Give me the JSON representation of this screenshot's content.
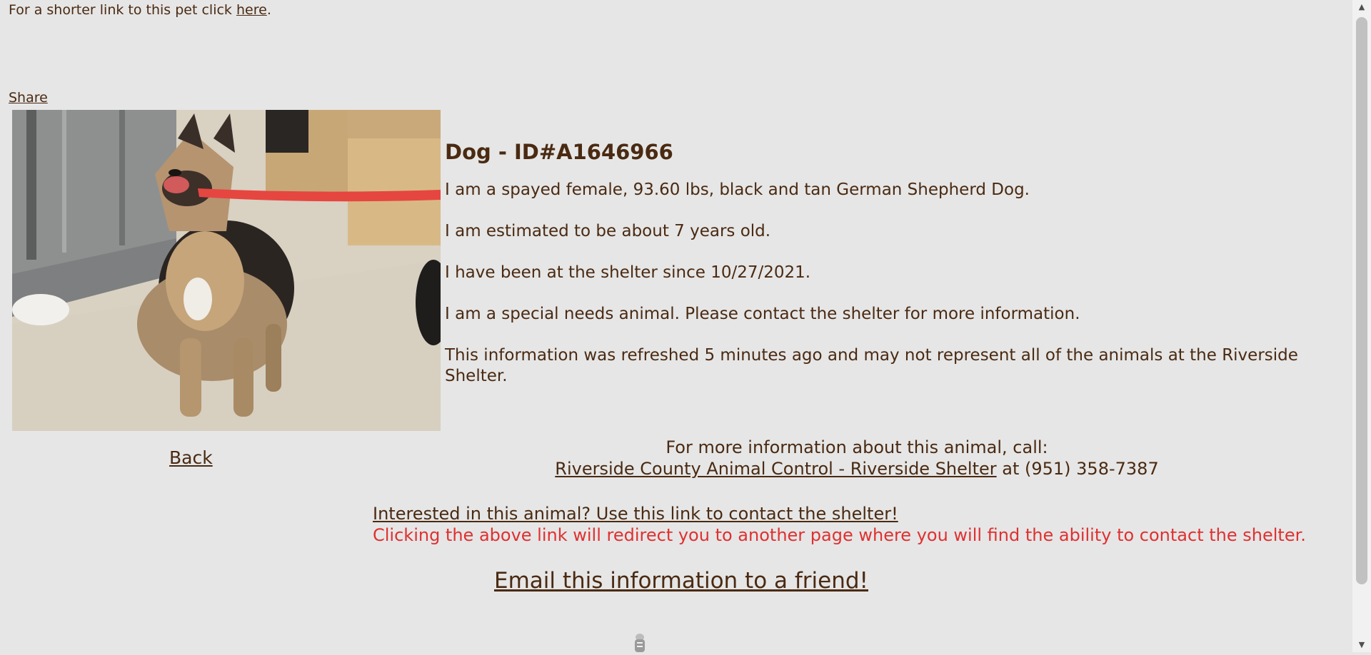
{
  "top": {
    "prefix": "For a shorter link to this pet click ",
    "link": "here",
    "suffix": "."
  },
  "share_label": "Share",
  "pet": {
    "title": "Dog - ID#A1646966",
    "description": "I am a spayed female, 93.60 lbs, black and tan German Shepherd Dog.",
    "age": "I am estimated to be about 7 years old.",
    "since": "I have been at the shelter since 10/27/2021.",
    "special": "I am a special needs animal. Please contact the shelter for more information.",
    "refresh": "This information was refreshed 5 minutes ago and may not represent all of the animals at the Riverside Shelter."
  },
  "back_label": "Back",
  "contact": {
    "line1": "For more information about this animal, call:",
    "shelter_link": "Riverside County Animal Control - Riverside Shelter",
    "phone_text": " at (951) 358-7387"
  },
  "interest": {
    "link": "Interested in this animal? Use this link to contact the shelter!",
    "note": "Clicking the above link will redirect you to another page where you will find the ability to contact the shelter."
  },
  "email_label": "Email this information to a friend!",
  "colors": {
    "background": "#e6e6e6",
    "text": "#4a2a12",
    "warning": "#e03030"
  },
  "icons": {
    "photo": "dog-photo",
    "loading": "loading-spinner-icon",
    "scroll_up": "scroll-up-arrow-icon",
    "scroll_down": "scroll-down-arrow-icon"
  }
}
